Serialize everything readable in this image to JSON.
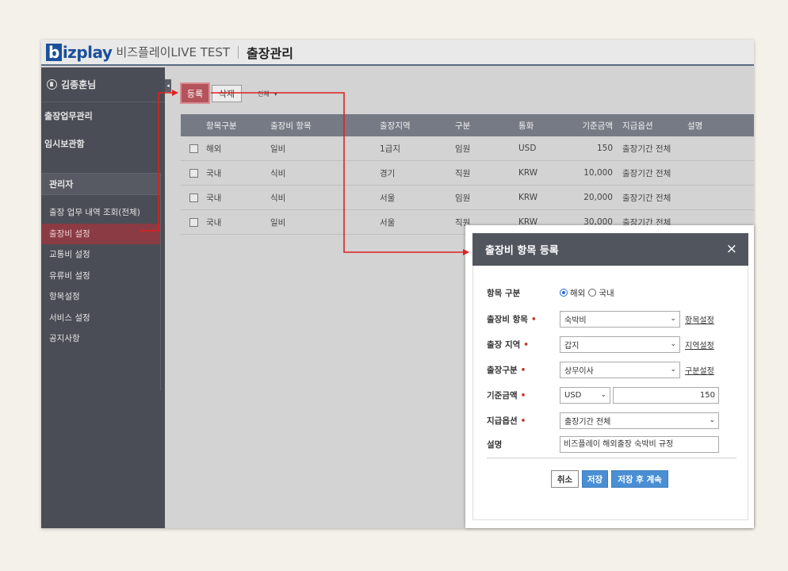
{
  "header": {
    "logo_b": "b",
    "logo_rest": "izplay",
    "brand": "비즈플레이LIVE TEST",
    "title": "출장관리"
  },
  "sidebar": {
    "user": "김종훈님",
    "menu": [
      "출장업무관리",
      "임시보관함"
    ],
    "admin_head": "관리자",
    "admin_items": [
      "출장 업무 내역 조회(전체)",
      "출장비 설정",
      "교통비 설정",
      "유류비 설정",
      "항목설정",
      "서비스 설정",
      "공지사항"
    ],
    "active_item": "출장비 설정"
  },
  "toolbar": {
    "register": "등록",
    "delete": "삭제",
    "all": "전체",
    "all_arrow": "▾"
  },
  "table": {
    "headers": [
      "항목구분",
      "출장비 항목",
      "출장지역",
      "구분",
      "통화",
      "기준금액",
      "지급옵션",
      "설명"
    ],
    "rows": [
      [
        "해외",
        "일비",
        "1급지",
        "임원",
        "USD",
        "150",
        "출장기간 전체",
        ""
      ],
      [
        "국내",
        "식비",
        "경기",
        "직원",
        "KRW",
        "10,000",
        "출장기간 전체",
        ""
      ],
      [
        "국내",
        "식비",
        "서울",
        "임원",
        "KRW",
        "20,000",
        "출장기간 전체",
        ""
      ],
      [
        "국내",
        "일비",
        "서울",
        "직원",
        "KRW",
        "30,000",
        "출장기간 전체",
        ""
      ]
    ]
  },
  "modal": {
    "title": "출장비 항목 등록",
    "close": "×",
    "fields": {
      "category_label": "항목 구분",
      "category_opt1": "해외",
      "category_opt2": "국내",
      "item_label": "출장비 항목",
      "item_value": "숙박비",
      "item_link": "항목설정",
      "region_label": "출장 지역",
      "region_value": "갑지",
      "region_link": "지역설정",
      "type_label": "출장구분",
      "type_value": "상무이사",
      "type_link": "구분설정",
      "amount_label": "기준금액",
      "currency_value": "USD",
      "amount_value": "150",
      "option_label": "지급옵션",
      "option_value": "출장기간 전체",
      "desc_label": "설명",
      "desc_value": "비즈플레이 해외출장 숙박비 규정"
    },
    "buttons": {
      "cancel": "취소",
      "save": "저장",
      "save_continue": "저장 후 계속"
    }
  },
  "colors": {
    "accent_red": "#e02020",
    "header_bar": "#51555e",
    "save_blue": "#4a8fd4"
  }
}
